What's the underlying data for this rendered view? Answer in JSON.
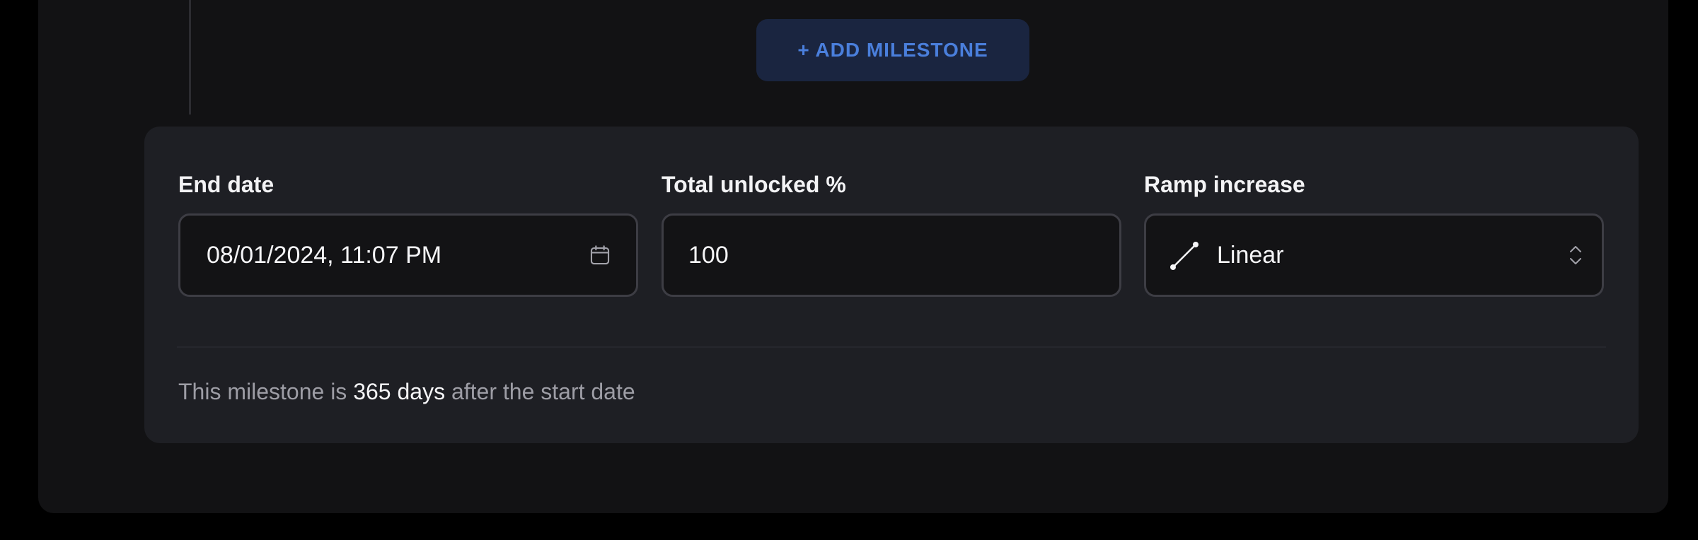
{
  "milestones": {
    "add_button_label": "+ ADD MILESTONE"
  },
  "milestone_card": {
    "end_date": {
      "label": "End date",
      "value": "08/01/2024, 11:07 PM",
      "icon": "calendar-icon"
    },
    "total_unlocked": {
      "label": "Total unlocked %",
      "value": "100"
    },
    "ramp_increase": {
      "label": "Ramp increase",
      "value": "Linear",
      "icon": "linear-ramp-icon",
      "chevron_icon": "chevron-up-down-icon"
    },
    "note": {
      "prefix": "This milestone is",
      "days": "365 days",
      "suffix": "after the start date"
    }
  },
  "colors": {
    "page_background": "#000000",
    "panel_background": "#121214",
    "card_background": "#1e1f24",
    "input_background": "#131315",
    "input_border": "#3d3d44",
    "accent": "#4a7fdc",
    "accent_button_background": "#1a2540",
    "muted_text": "#9d9da5",
    "primary_text": "#f5f5f7"
  }
}
